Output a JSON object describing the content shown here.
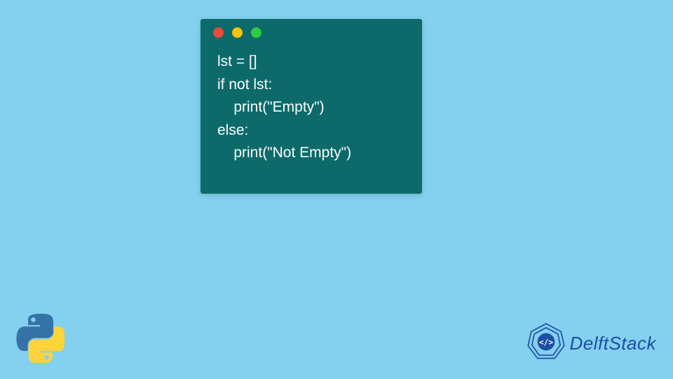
{
  "code": {
    "lines": [
      "lst = []",
      "if not lst:",
      "    print(\"Empty\")",
      "else:",
      "    print(\"Not Empty\")"
    ]
  },
  "window": {
    "dot_colors": {
      "red": "#e74c3c",
      "yellow": "#f1c40f",
      "green": "#2ecc40"
    },
    "background": "#0d6a6a"
  },
  "page": {
    "background": "#83d0ef"
  },
  "branding": {
    "delftstack_text": "DelftStack",
    "delftstack_color": "#1d4ea3",
    "python_icon": "python-logo"
  }
}
